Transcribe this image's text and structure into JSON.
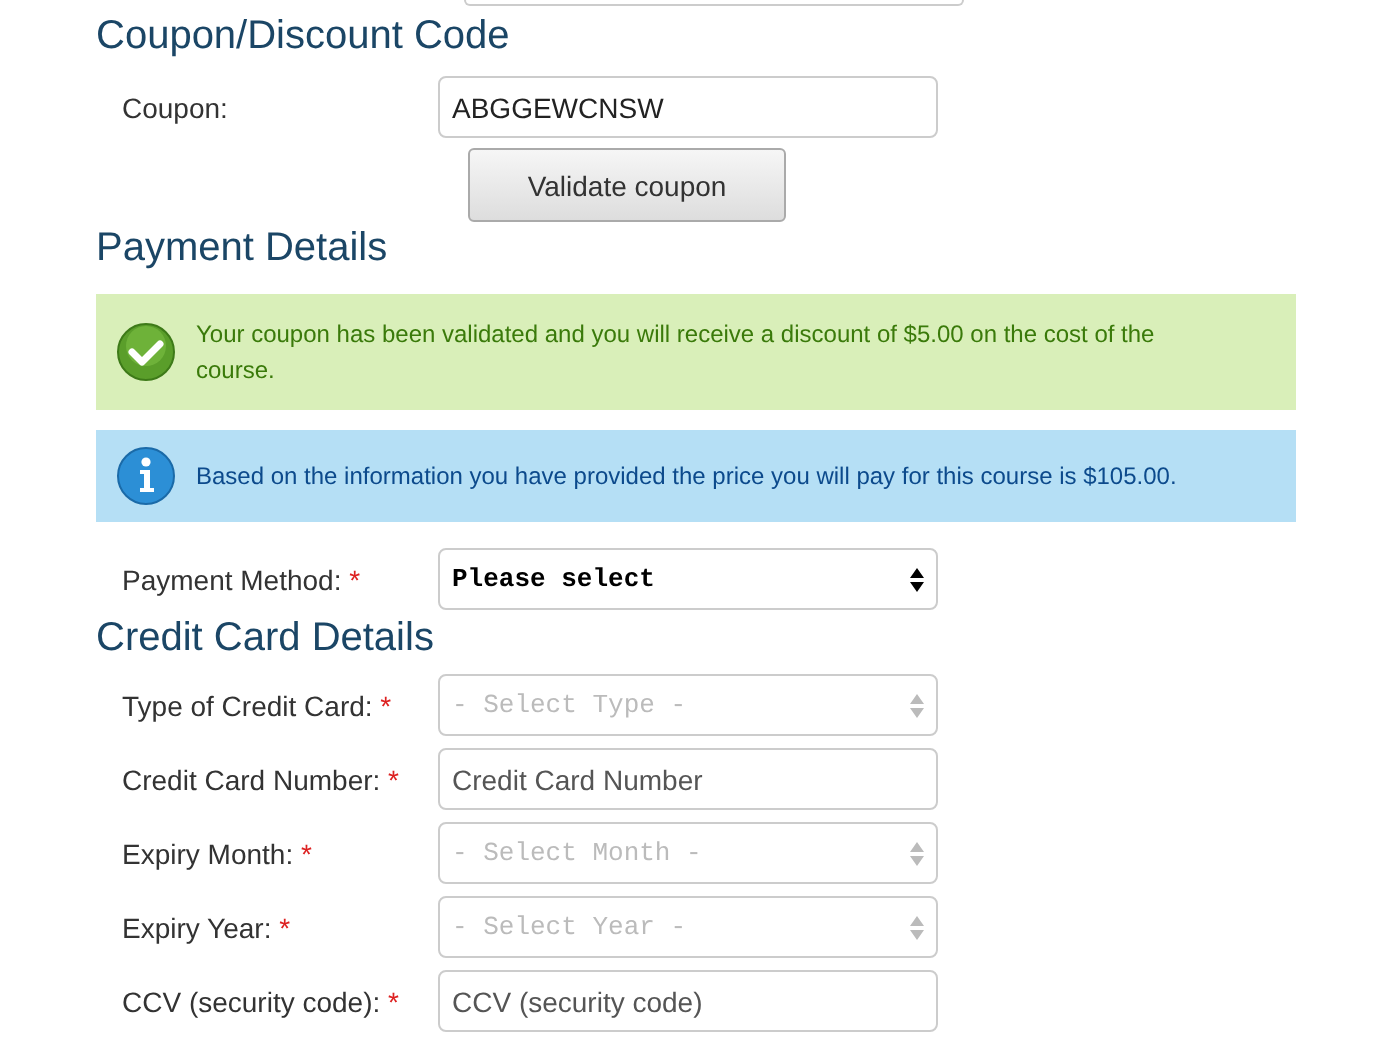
{
  "coupon_section": {
    "heading": "Coupon/Discount Code",
    "label": "Coupon:",
    "value": "ABGGEWCNSW",
    "button": "Validate coupon"
  },
  "payment_section": {
    "heading": "Payment Details",
    "alerts": [
      {
        "kind": "success",
        "text": "Your coupon has been validated and you will receive a discount of $5.00 on the cost of the course."
      },
      {
        "kind": "info",
        "text": "Based on the information you have provided the price you will pay for this course is $105.00."
      }
    ],
    "fields": [
      {
        "kind": "select",
        "label": "Payment Method:",
        "required_mark": "*",
        "value": "Please select",
        "disabled": false
      }
    ]
  },
  "credit_card_section": {
    "heading": "Credit Card Details",
    "fields": [
      {
        "kind": "select",
        "label": "Type of Credit Card:",
        "required_mark": "*",
        "value": "- Select Type -",
        "disabled": true
      },
      {
        "kind": "text",
        "label": "Credit Card Number:",
        "required_mark": "*",
        "placeholder": "Credit Card Number"
      },
      {
        "kind": "select",
        "label": "Expiry Month:",
        "required_mark": "*",
        "value": "- Select Month -",
        "disabled": true
      },
      {
        "kind": "select",
        "label": "Expiry Year:",
        "required_mark": "*",
        "value": "- Select Year -",
        "disabled": true
      },
      {
        "kind": "text",
        "label": "CCV (security code):",
        "required_mark": "*",
        "placeholder": "CCV (security code)"
      }
    ]
  }
}
